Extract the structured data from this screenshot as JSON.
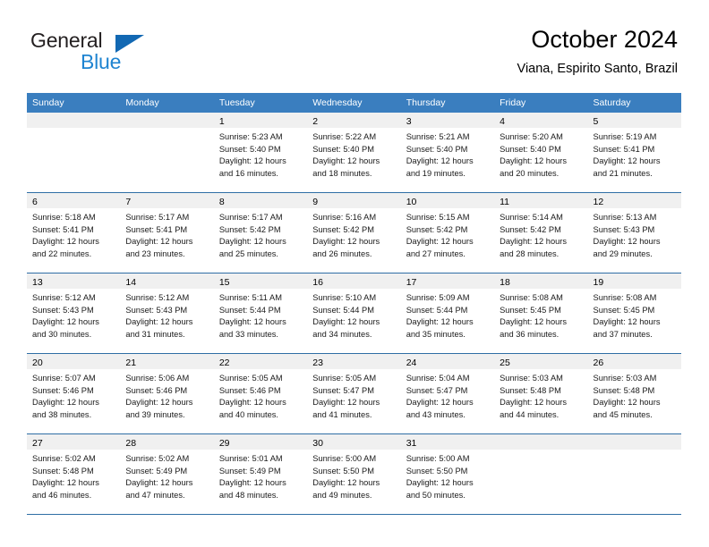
{
  "brand": {
    "name_part1": "General",
    "name_part2": "Blue",
    "triangle_icon": "triangle-icon",
    "accent_color": "#1268b3",
    "secondary_color": "#1f84d1"
  },
  "header": {
    "title": "October 2024",
    "subtitle": "Viana, Espirito Santo, Brazil"
  },
  "calendar": {
    "header_bg": "#3a7ebf",
    "row_divider": "#2f6ea5",
    "daynum_bg": "#f0f0f0",
    "weekdays": [
      "Sunday",
      "Monday",
      "Tuesday",
      "Wednesday",
      "Thursday",
      "Friday",
      "Saturday"
    ],
    "weeks": [
      [
        {
          "day": "",
          "lines": []
        },
        {
          "day": "",
          "lines": []
        },
        {
          "day": "1",
          "lines": [
            "Sunrise: 5:23 AM",
            "Sunset: 5:40 PM",
            "Daylight: 12 hours",
            "and 16 minutes."
          ]
        },
        {
          "day": "2",
          "lines": [
            "Sunrise: 5:22 AM",
            "Sunset: 5:40 PM",
            "Daylight: 12 hours",
            "and 18 minutes."
          ]
        },
        {
          "day": "3",
          "lines": [
            "Sunrise: 5:21 AM",
            "Sunset: 5:40 PM",
            "Daylight: 12 hours",
            "and 19 minutes."
          ]
        },
        {
          "day": "4",
          "lines": [
            "Sunrise: 5:20 AM",
            "Sunset: 5:40 PM",
            "Daylight: 12 hours",
            "and 20 minutes."
          ]
        },
        {
          "day": "5",
          "lines": [
            "Sunrise: 5:19 AM",
            "Sunset: 5:41 PM",
            "Daylight: 12 hours",
            "and 21 minutes."
          ]
        }
      ],
      [
        {
          "day": "6",
          "lines": [
            "Sunrise: 5:18 AM",
            "Sunset: 5:41 PM",
            "Daylight: 12 hours",
            "and 22 minutes."
          ]
        },
        {
          "day": "7",
          "lines": [
            "Sunrise: 5:17 AM",
            "Sunset: 5:41 PM",
            "Daylight: 12 hours",
            "and 23 minutes."
          ]
        },
        {
          "day": "8",
          "lines": [
            "Sunrise: 5:17 AM",
            "Sunset: 5:42 PM",
            "Daylight: 12 hours",
            "and 25 minutes."
          ]
        },
        {
          "day": "9",
          "lines": [
            "Sunrise: 5:16 AM",
            "Sunset: 5:42 PM",
            "Daylight: 12 hours",
            "and 26 minutes."
          ]
        },
        {
          "day": "10",
          "lines": [
            "Sunrise: 5:15 AM",
            "Sunset: 5:42 PM",
            "Daylight: 12 hours",
            "and 27 minutes."
          ]
        },
        {
          "day": "11",
          "lines": [
            "Sunrise: 5:14 AM",
            "Sunset: 5:42 PM",
            "Daylight: 12 hours",
            "and 28 minutes."
          ]
        },
        {
          "day": "12",
          "lines": [
            "Sunrise: 5:13 AM",
            "Sunset: 5:43 PM",
            "Daylight: 12 hours",
            "and 29 minutes."
          ]
        }
      ],
      [
        {
          "day": "13",
          "lines": [
            "Sunrise: 5:12 AM",
            "Sunset: 5:43 PM",
            "Daylight: 12 hours",
            "and 30 minutes."
          ]
        },
        {
          "day": "14",
          "lines": [
            "Sunrise: 5:12 AM",
            "Sunset: 5:43 PM",
            "Daylight: 12 hours",
            "and 31 minutes."
          ]
        },
        {
          "day": "15",
          "lines": [
            "Sunrise: 5:11 AM",
            "Sunset: 5:44 PM",
            "Daylight: 12 hours",
            "and 33 minutes."
          ]
        },
        {
          "day": "16",
          "lines": [
            "Sunrise: 5:10 AM",
            "Sunset: 5:44 PM",
            "Daylight: 12 hours",
            "and 34 minutes."
          ]
        },
        {
          "day": "17",
          "lines": [
            "Sunrise: 5:09 AM",
            "Sunset: 5:44 PM",
            "Daylight: 12 hours",
            "and 35 minutes."
          ]
        },
        {
          "day": "18",
          "lines": [
            "Sunrise: 5:08 AM",
            "Sunset: 5:45 PM",
            "Daylight: 12 hours",
            "and 36 minutes."
          ]
        },
        {
          "day": "19",
          "lines": [
            "Sunrise: 5:08 AM",
            "Sunset: 5:45 PM",
            "Daylight: 12 hours",
            "and 37 minutes."
          ]
        }
      ],
      [
        {
          "day": "20",
          "lines": [
            "Sunrise: 5:07 AM",
            "Sunset: 5:46 PM",
            "Daylight: 12 hours",
            "and 38 minutes."
          ]
        },
        {
          "day": "21",
          "lines": [
            "Sunrise: 5:06 AM",
            "Sunset: 5:46 PM",
            "Daylight: 12 hours",
            "and 39 minutes."
          ]
        },
        {
          "day": "22",
          "lines": [
            "Sunrise: 5:05 AM",
            "Sunset: 5:46 PM",
            "Daylight: 12 hours",
            "and 40 minutes."
          ]
        },
        {
          "day": "23",
          "lines": [
            "Sunrise: 5:05 AM",
            "Sunset: 5:47 PM",
            "Daylight: 12 hours",
            "and 41 minutes."
          ]
        },
        {
          "day": "24",
          "lines": [
            "Sunrise: 5:04 AM",
            "Sunset: 5:47 PM",
            "Daylight: 12 hours",
            "and 43 minutes."
          ]
        },
        {
          "day": "25",
          "lines": [
            "Sunrise: 5:03 AM",
            "Sunset: 5:48 PM",
            "Daylight: 12 hours",
            "and 44 minutes."
          ]
        },
        {
          "day": "26",
          "lines": [
            "Sunrise: 5:03 AM",
            "Sunset: 5:48 PM",
            "Daylight: 12 hours",
            "and 45 minutes."
          ]
        }
      ],
      [
        {
          "day": "27",
          "lines": [
            "Sunrise: 5:02 AM",
            "Sunset: 5:48 PM",
            "Daylight: 12 hours",
            "and 46 minutes."
          ]
        },
        {
          "day": "28",
          "lines": [
            "Sunrise: 5:02 AM",
            "Sunset: 5:49 PM",
            "Daylight: 12 hours",
            "and 47 minutes."
          ]
        },
        {
          "day": "29",
          "lines": [
            "Sunrise: 5:01 AM",
            "Sunset: 5:49 PM",
            "Daylight: 12 hours",
            "and 48 minutes."
          ]
        },
        {
          "day": "30",
          "lines": [
            "Sunrise: 5:00 AM",
            "Sunset: 5:50 PM",
            "Daylight: 12 hours",
            "and 49 minutes."
          ]
        },
        {
          "day": "31",
          "lines": [
            "Sunrise: 5:00 AM",
            "Sunset: 5:50 PM",
            "Daylight: 12 hours",
            "and 50 minutes."
          ]
        },
        {
          "day": "",
          "lines": []
        },
        {
          "day": "",
          "lines": []
        }
      ]
    ]
  }
}
